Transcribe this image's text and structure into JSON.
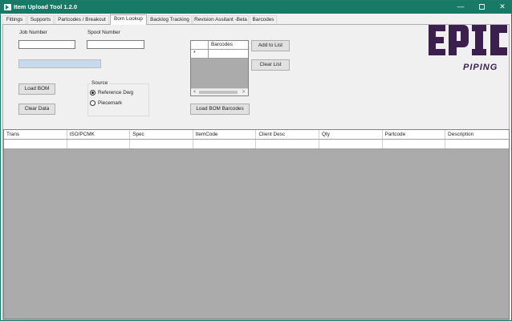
{
  "window": {
    "title": "Item Upload Tool 1.2.0",
    "controls": {
      "minimize": "—",
      "close": "✕"
    }
  },
  "tabs": [
    {
      "label": "Fittings"
    },
    {
      "label": "Supports"
    },
    {
      "label": "Partcodes / Breakout"
    },
    {
      "label": "Bom Lookup",
      "active": true
    },
    {
      "label": "Backlog Tracking"
    },
    {
      "label": "Revision Assitant -Beta"
    },
    {
      "label": "Barcodes"
    }
  ],
  "form": {
    "job_number_label": "Job Number",
    "job_number_value": "",
    "spool_number_label": "Spool Number",
    "spool_number_value": "",
    "load_bom_label": "Load BOM",
    "clear_data_label": "Clear Data",
    "source": {
      "title": "Source",
      "options": [
        {
          "label": "Reference Dwg",
          "checked": true
        },
        {
          "label": "Piecemark",
          "checked": false
        }
      ]
    }
  },
  "barcodes_grid": {
    "header": "Barcodes",
    "row_marker": "*",
    "scroll_left": "<",
    "scroll_right": ">"
  },
  "barcode_buttons": {
    "add_to_list": "Add to List",
    "clear_list": "Clear List",
    "load_bom_barcodes": "Load BOM Barcodes"
  },
  "logo": {
    "main": "EPIC",
    "sub": "PIPING",
    "color": "#3b1f4f"
  },
  "results_grid": {
    "columns": [
      "Trans",
      "ISO/PCMK",
      "Spec",
      "ItemCode",
      "Client Desc",
      "Qty",
      "Partcode",
      "Description"
    ],
    "rows": [
      [
        "",
        "",
        "",
        "",
        "",
        "",
        "",
        ""
      ]
    ]
  },
  "colors": {
    "titlebar": "#167a66",
    "grid_background": "#ababab"
  }
}
